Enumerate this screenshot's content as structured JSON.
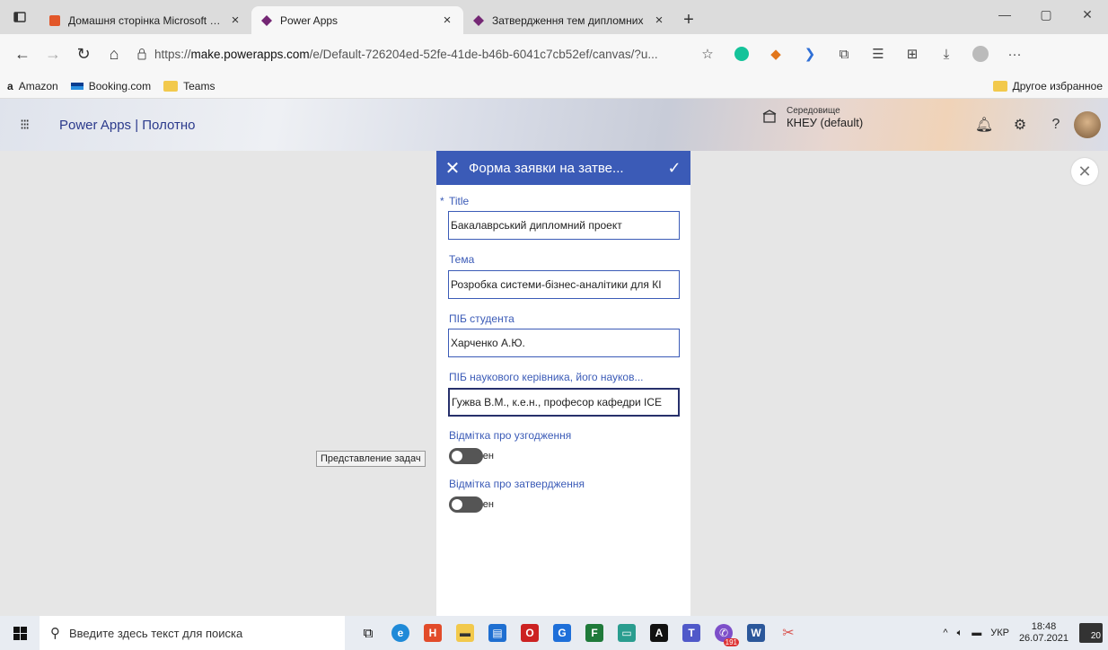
{
  "browser": {
    "tabs": [
      {
        "title": "Домашня сторінка Microsoft Of",
        "active": false,
        "color": "#e2572a"
      },
      {
        "title": "Power Apps",
        "active": true,
        "color": "#742774"
      },
      {
        "title": "Затвердження тем дипломних",
        "active": false,
        "color": "#742774"
      }
    ],
    "new_tab": "+",
    "address": {
      "prefix": "https://",
      "host": "make.powerapps.com",
      "path": "/e/Default-726204ed-52fe-41de-b46b-6041c7cb52ef/canvas/?u..."
    },
    "bookmarks": [
      {
        "label": "Amazon",
        "icon": "amazon-icon"
      },
      {
        "label": "Booking.com",
        "icon": "booking-icon"
      },
      {
        "label": "Teams",
        "icon": "folder-icon"
      }
    ],
    "other_bookmarks": "Другое избранное"
  },
  "powerapps": {
    "title": "Power Apps | Полотно",
    "environment_label": "Середовище",
    "environment_value": "КНЕУ (default)"
  },
  "form": {
    "header_title": "Форма заявки на затве...",
    "title_label": "Title",
    "title_value": "Бакалаврський дипломний проект",
    "tema_label": "Тема",
    "tema_value": "Розробка системи-бізнес-аналітики для КІ",
    "student_label": "ПІБ студента",
    "student_value": "Харченко А.Ю.",
    "supervisor_label": "ПІБ наукового керівника, його науков...",
    "supervisor_value": "Гужва В.М., к.е.н., професор кафедри ІСЕ",
    "agreement_label": "Відмітка про узгодження",
    "agreement_state": "чен",
    "approval_label": "Відмітка про затвердження",
    "approval_state": "чен"
  },
  "tooltip": "Представление задач",
  "taskbar": {
    "search_placeholder": "Введите здесь текст для поиска",
    "language": "УКР",
    "time": "18:48",
    "date": "26.07.2021",
    "notifications": "20",
    "badge_count": "191"
  },
  "colors": {
    "form_accent": "#3b5bb7",
    "tab_bar": "#dcdcdc",
    "canvas_bg": "#e6e6e6"
  }
}
